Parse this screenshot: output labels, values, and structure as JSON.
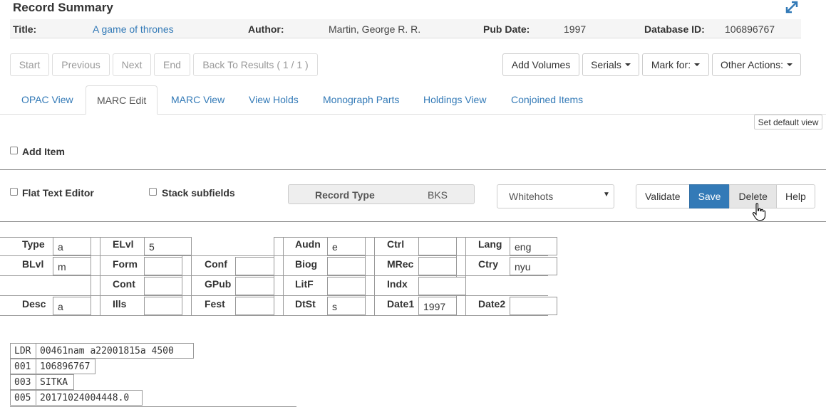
{
  "page": {
    "title": "Record Summary"
  },
  "summary": {
    "title_label": "Title:",
    "title_value": "A game of thrones",
    "author_label": "Author:",
    "author_value": "Martin, George R. R.",
    "pubdate_label": "Pub Date:",
    "pubdate_value": "1997",
    "dbid_label": "Database ID:",
    "dbid_value": "106896767"
  },
  "nav": {
    "start": "Start",
    "previous": "Previous",
    "next": "Next",
    "end": "End",
    "back": "Back To Results ( 1 / 1 )",
    "add_volumes": "Add Volumes",
    "serials": "Serials",
    "mark_for": "Mark for:",
    "other_actions": "Other Actions:"
  },
  "tabs": [
    "OPAC View",
    "MARC Edit",
    "MARC View",
    "View Holds",
    "Monograph Parts",
    "Holdings View",
    "Conjoined Items"
  ],
  "set_default_view": "Set default view",
  "add_item": "Add Item",
  "editor": {
    "flat_text": "Flat Text Editor",
    "stack_subfields": "Stack subfields",
    "record_type_label": "Record Type",
    "record_type_value": "BKS",
    "template_selected": "Whitehots",
    "validate": "Validate",
    "save": "Save",
    "delete": "Delete",
    "help": "Help"
  },
  "fixed_fields": {
    "type_l": "Type",
    "type_v": "a",
    "elvl_l": "ELvl",
    "elvl_v": "5",
    "audn_l": "Audn",
    "audn_v": "e",
    "ctrl_l": "Ctrl",
    "ctrl_v": "",
    "lang_l": "Lang",
    "lang_v": "eng",
    "blvl_l": "BLvl",
    "blvl_v": "m",
    "form_l": "Form",
    "form_v": "",
    "conf_l": "Conf",
    "conf_v": "",
    "biog_l": "Biog",
    "biog_v": "",
    "mrec_l": "MRec",
    "mrec_v": "",
    "ctry_l": "Ctry",
    "ctry_v": "nyu",
    "cont_l": "Cont",
    "cont_v": "",
    "gpub_l": "GPub",
    "gpub_v": "",
    "litf_l": "LitF",
    "litf_v": "",
    "indx_l": "Indx",
    "indx_v": "",
    "desc_l": "Desc",
    "desc_v": "a",
    "ills_l": "Ills",
    "ills_v": "",
    "fest_l": "Fest",
    "fest_v": "",
    "dtst_l": "DtSt",
    "dtst_v": "s",
    "date1_l": "Date1",
    "date1_v": "1997",
    "date2_l": "Date2",
    "date2_v": ""
  },
  "marc": [
    {
      "tag": "LDR",
      "value": "00461nam a22001815a 4500"
    },
    {
      "tag": "001",
      "value": "106896767"
    },
    {
      "tag": "003",
      "value": "SITKA"
    },
    {
      "tag": "005",
      "value": "20171024004448.0"
    }
  ],
  "colors": {
    "link": "#337ab7",
    "primary": "#337ab7"
  }
}
